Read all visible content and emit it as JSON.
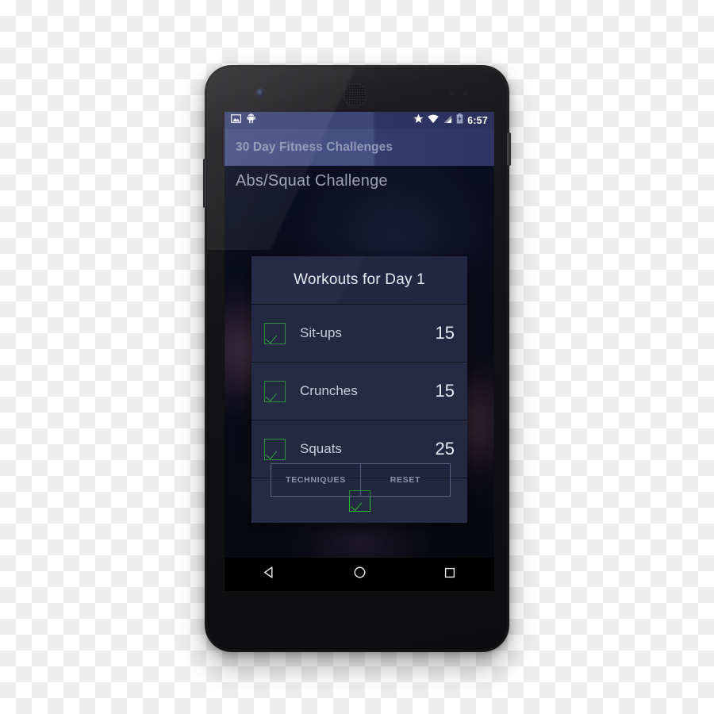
{
  "device": {
    "name": "android-phone",
    "model_style": "nexus-5"
  },
  "status_bar": {
    "left_icons": [
      "screenshot-icon",
      "android-bugdroid-icon"
    ],
    "right_icons": [
      "star-icon",
      "wifi-icon",
      "signal-icon",
      "battery-charging-icon"
    ],
    "time": "6:57"
  },
  "action_bar": {
    "title": "30 Day Fitness Challenges"
  },
  "content": {
    "heading": "Abs/Squat Challenge"
  },
  "dialog": {
    "title": "Workouts for Day 1",
    "rows": [
      {
        "label": "Sit-ups",
        "value": "15",
        "checked": true
      },
      {
        "label": "Crunches",
        "value": "15",
        "checked": true
      },
      {
        "label": "Squats",
        "value": "25",
        "checked": true
      }
    ],
    "confirm_checkbox": {
      "checked": true,
      "icon": "checkmark-icon"
    }
  },
  "buttons": {
    "techniques": "TECHNIQUES",
    "reset": "RESET"
  },
  "nav_bar": {
    "back": "back-icon",
    "home": "home-icon",
    "recents": "recents-icon"
  },
  "colors": {
    "status_bar": "#3e4677",
    "action_bar": "#464f82",
    "dialog_bg": "#242942",
    "checkbox_green": "#2f8f3f",
    "checkbox_bright_green": "#2cc02c",
    "text_primary": "#e8eaf2",
    "text_secondary": "#9099b8"
  }
}
